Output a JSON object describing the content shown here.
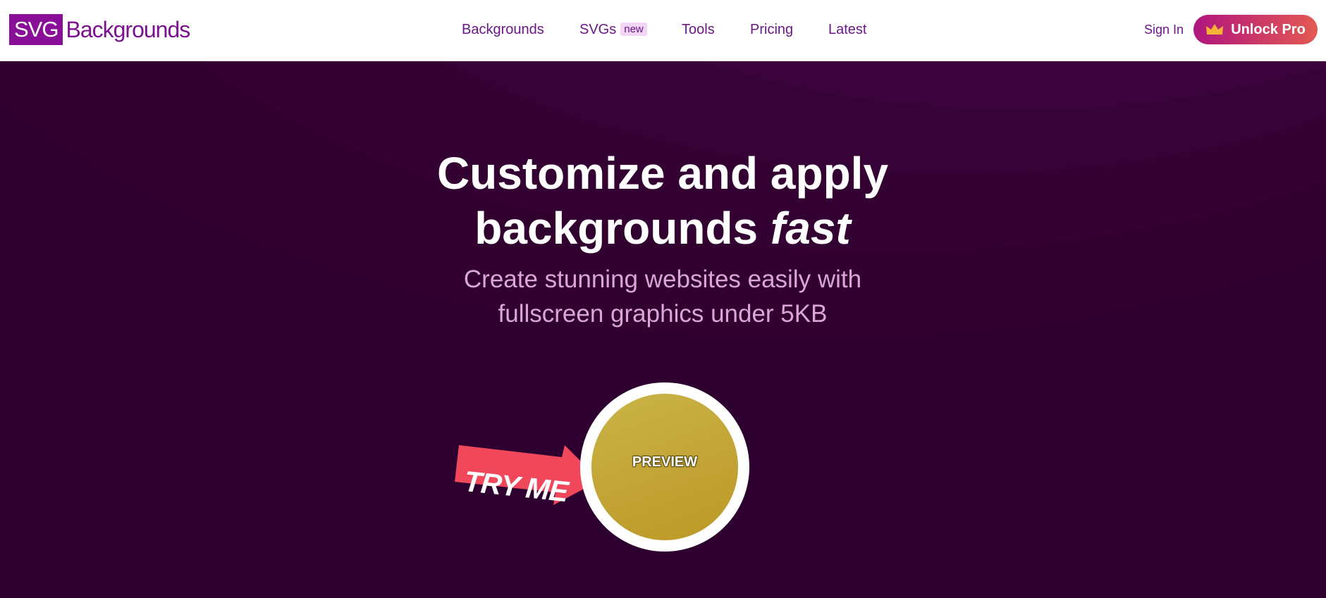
{
  "logo": {
    "box_text": "SVG",
    "text": "Backgrounds"
  },
  "nav": [
    {
      "label": "Backgrounds"
    },
    {
      "label": "SVGs",
      "badge": "new"
    },
    {
      "label": "Tools"
    },
    {
      "label": "Pricing"
    },
    {
      "label": "Latest"
    }
  ],
  "header": {
    "signin_label": "Sign In",
    "pro_label": "Unlock Pro",
    "pro_icon": "crown-icon"
  },
  "hero": {
    "title_line1": "Customize and apply",
    "title_line2": "backgrounds",
    "title_emphasis": "fast",
    "subtitle_line1": "Create stunning websites easily with",
    "subtitle_line2": "fullscreen graphics under 5KB",
    "preview_label": "PREVIEW",
    "try_me_label": "TRY ME"
  },
  "colors": {
    "brand": "#8a0f98",
    "nav_text": "#6b1786",
    "hero_bg": "#2e0030",
    "preview_gold": "#c3a335",
    "try_me_red": "#f0485a"
  }
}
